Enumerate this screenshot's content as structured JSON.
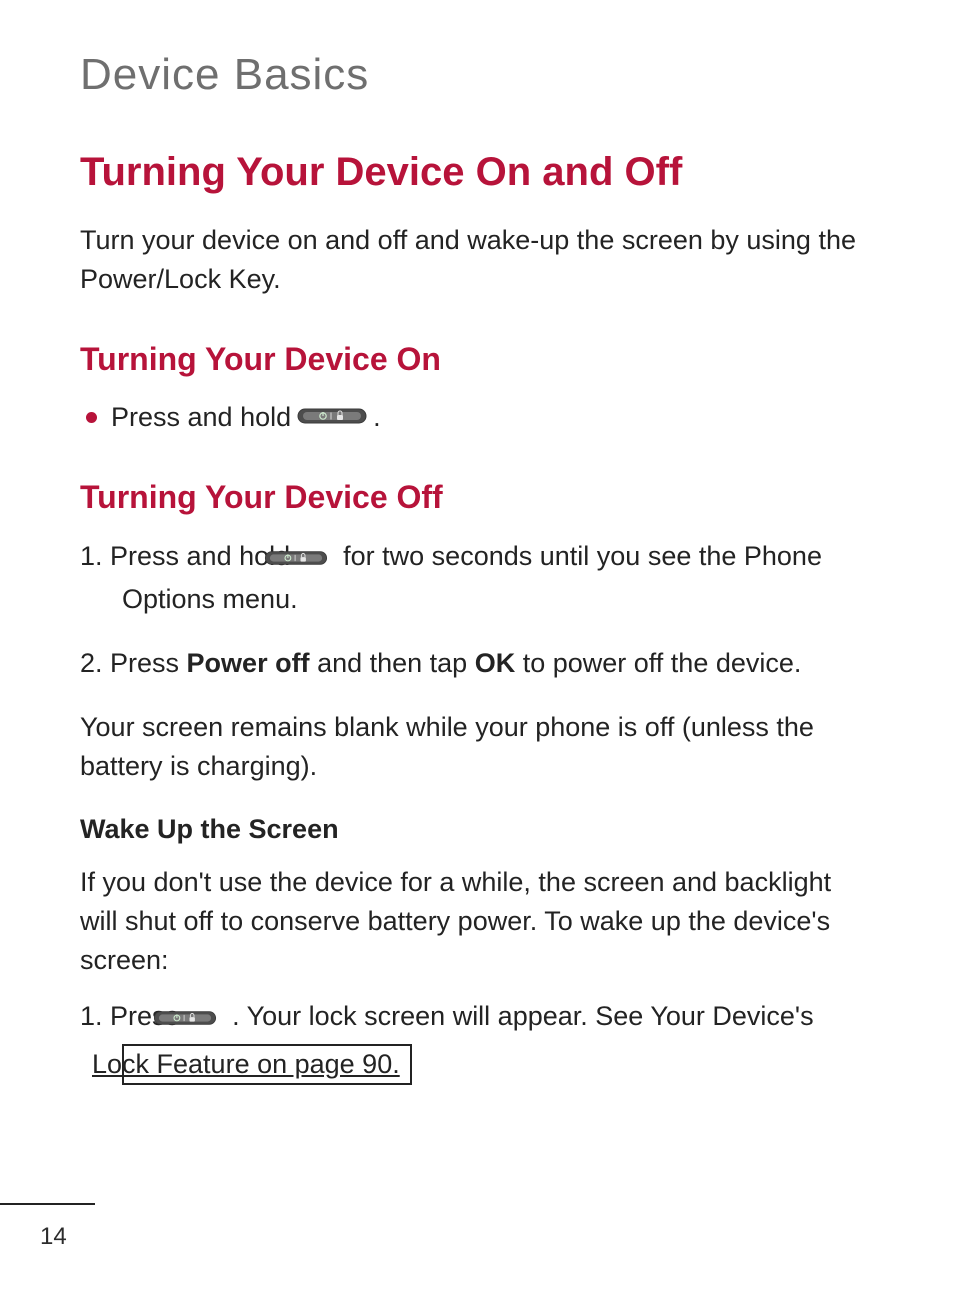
{
  "section_title": "Device Basics",
  "h1": "Turning Your Device On and Off",
  "intro": "Turn your device on and off and wake-up the screen by using the Power/Lock Key.",
  "on": {
    "heading": "Turning Your Device On",
    "bullet_text_before": "Press and hold ",
    "bullet_text_after": " ."
  },
  "off": {
    "heading": "Turning Your Device Off",
    "step1_before": "1. Press and hold ",
    "step1_after": " for two seconds until you see the Phone Options menu.",
    "step2_prefix": "2. Press ",
    "step2_bold1": "Power off",
    "step2_mid": " and then tap ",
    "step2_bold2": "OK",
    "step2_suffix": " to power off the device.",
    "note": "Your screen remains blank while your phone is off (unless the battery is charging)."
  },
  "wake": {
    "subhead": "Wake Up the Screen",
    "intro": "If you don't use the device for a while, the screen and backlight will shut off to conserve battery power. To wake up the device's screen:",
    "step1_before": "1. Press ",
    "step1_after": ". Your lock screen will appear. See Your Device's ",
    "xref": "Lock Feature on page 90."
  },
  "icons": {
    "power_lock_key": "power-lock-key-icon"
  },
  "page_number": "14"
}
